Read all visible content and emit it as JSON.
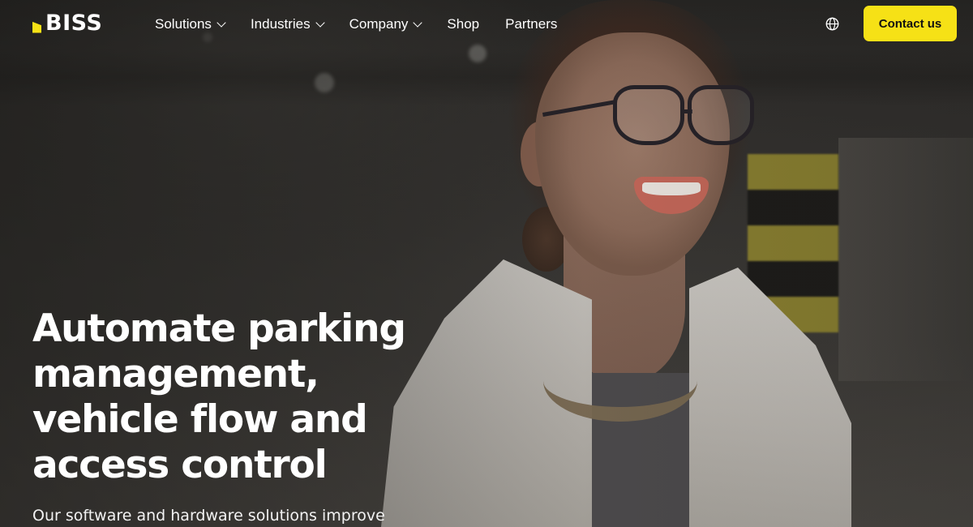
{
  "brand": {
    "name": "BISS",
    "accent_color": "#f6e116"
  },
  "nav": {
    "items": [
      {
        "label": "Solutions",
        "has_dropdown": true
      },
      {
        "label": "Industries",
        "has_dropdown": true
      },
      {
        "label": "Company",
        "has_dropdown": true
      },
      {
        "label": "Shop",
        "has_dropdown": false
      },
      {
        "label": "Partners",
        "has_dropdown": false
      }
    ],
    "language_icon": "globe-icon",
    "cta_label": "Contact us"
  },
  "hero": {
    "title_lines": [
      "Automate parking",
      "management,",
      "vehicle flow and",
      "access control"
    ],
    "subtitle": "Our software and hardware solutions improve"
  }
}
